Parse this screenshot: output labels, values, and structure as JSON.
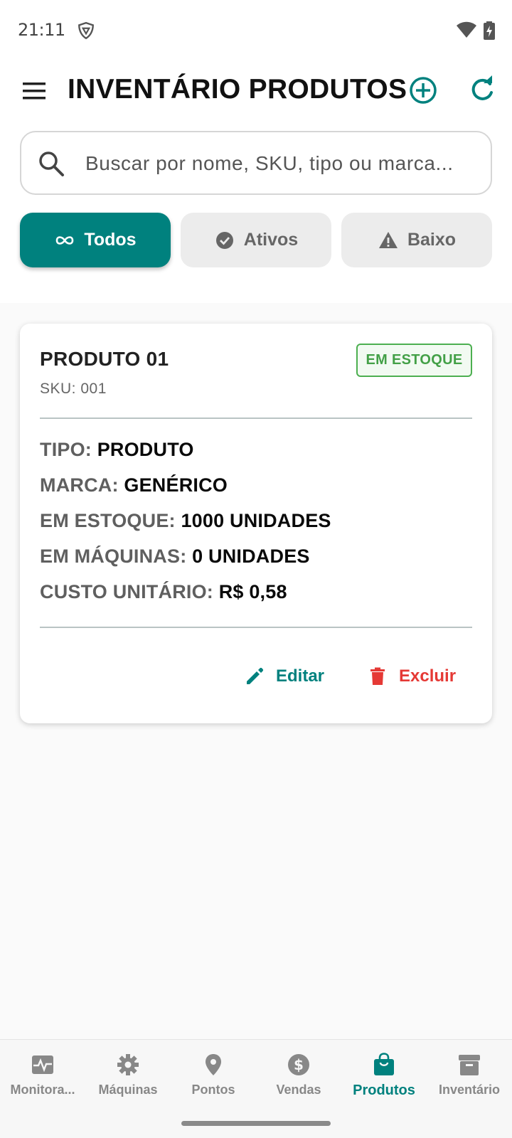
{
  "status_bar": {
    "time": "21:11"
  },
  "header": {
    "title": "INVENTÁRIO PRODUTOS"
  },
  "search": {
    "placeholder": "Buscar por nome, SKU, tipo ou marca..."
  },
  "filters": [
    {
      "label": "Todos",
      "icon": "infinity-icon",
      "selected": true
    },
    {
      "label": "Ativos",
      "icon": "check-circle-icon",
      "selected": false
    },
    {
      "label": "Baixo",
      "icon": "warning-icon",
      "selected": false
    }
  ],
  "product": {
    "name": "PRODUTO 01",
    "sku": "SKU: 001",
    "badge": "EM ESTOQUE",
    "details": [
      {
        "label": "TIPO:",
        "value": "PRODUTO"
      },
      {
        "label": "MARCA:",
        "value": "GENÉRICO"
      },
      {
        "label": "EM ESTOQUE:",
        "value": "1000 UNIDADES"
      },
      {
        "label": "EM MÁQUINAS:",
        "value": "0 UNIDADES"
      },
      {
        "label": "CUSTO UNITÁRIO:",
        "value": "R$ 0,58"
      }
    ],
    "edit_label": "Editar",
    "delete_label": "Excluir"
  },
  "bottom_nav": [
    {
      "label": "Monitora...",
      "icon": "activity-icon",
      "active": false
    },
    {
      "label": "Máquinas",
      "icon": "gear-icon",
      "active": false
    },
    {
      "label": "Pontos",
      "icon": "location-pin-icon",
      "active": false
    },
    {
      "label": "Vendas",
      "icon": "dollar-icon",
      "active": false
    },
    {
      "label": "Produtos",
      "icon": "shopping-bag-icon",
      "active": true
    },
    {
      "label": "Inventário",
      "icon": "archive-icon",
      "active": false
    }
  ],
  "colors": {
    "primary": "#00817e",
    "in_stock": "#43a047",
    "danger": "#e53935"
  }
}
